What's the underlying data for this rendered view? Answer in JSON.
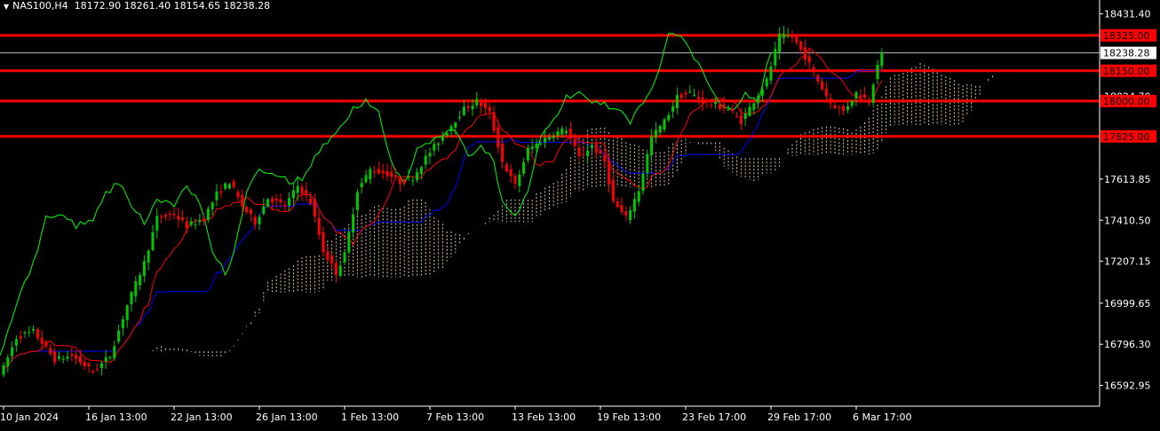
{
  "header": {
    "symbol_timeframe": "NAS100,H4",
    "open": "18172.90",
    "high": "18261.40",
    "low": "18154.65",
    "close": "18238.28"
  },
  "chart_data": {
    "type": "candlestick",
    "symbol": "NAS100",
    "timeframe": "H4",
    "ylim": [
      16490,
      18500
    ],
    "y_ticks": [
      "18431.40",
      "18024.70",
      "17613.85",
      "17410.50",
      "17207.15",
      "16999.65",
      "16796.30",
      "16592.95"
    ],
    "x_ticks": [
      "10 Jan 2024",
      "16 Jan 13:00",
      "22 Jan 13:00",
      "26 Jan 13:00",
      "1 Feb 13:00",
      "7 Feb 13:00",
      "13 Feb 13:00",
      "19 Feb 13:00",
      "23 Feb 17:00",
      "29 Feb 17:00",
      "6 Mar 17:00"
    ],
    "x_tick_index": [
      0,
      20,
      40,
      60,
      80,
      100,
      120,
      140,
      160,
      180,
      200
    ],
    "current_price": {
      "value": 18238.28,
      "label": "18238.28"
    },
    "levels": [
      {
        "value": 18325,
        "label": "18325.00"
      },
      {
        "value": 18150,
        "label": "18150.00"
      },
      {
        "value": 18000,
        "label": "18000.00"
      },
      {
        "value": 17825,
        "label": "17825.00"
      }
    ],
    "colors": {
      "background": "#000000",
      "bull": "#00c800",
      "bear": "#ff0000",
      "tenkan": "#ff0000",
      "kijun": "#0000ff",
      "chikou": "#00ff00",
      "cloud": "#f5deb3",
      "level": "#ff0000",
      "grid_text": "#ffffff"
    },
    "waypoints": [
      [
        0,
        16680
      ],
      [
        3,
        16830
      ],
      [
        7,
        16860
      ],
      [
        12,
        16720
      ],
      [
        16,
        16740
      ],
      [
        21,
        16660
      ],
      [
        25,
        16740
      ],
      [
        29,
        16990
      ],
      [
        33,
        17200
      ],
      [
        36,
        17420
      ],
      [
        40,
        17440
      ],
      [
        43,
        17380
      ],
      [
        47,
        17420
      ],
      [
        50,
        17540
      ],
      [
        53,
        17600
      ],
      [
        56,
        17480
      ],
      [
        59,
        17400
      ],
      [
        62,
        17520
      ],
      [
        66,
        17480
      ],
      [
        69,
        17580
      ],
      [
        72,
        17500
      ],
      [
        75,
        17260
      ],
      [
        78,
        17150
      ],
      [
        80,
        17240
      ],
      [
        83,
        17560
      ],
      [
        86,
        17660
      ],
      [
        90,
        17640
      ],
      [
        93,
        17600
      ],
      [
        96,
        17620
      ],
      [
        99,
        17720
      ],
      [
        102,
        17800
      ],
      [
        105,
        17880
      ],
      [
        108,
        17960
      ],
      [
        111,
        18000
      ],
      [
        114,
        17940
      ],
      [
        117,
        17700
      ],
      [
        120,
        17580
      ],
      [
        123,
        17760
      ],
      [
        126,
        17800
      ],
      [
        129,
        17840
      ],
      [
        132,
        17860
      ],
      [
        135,
        17720
      ],
      [
        138,
        17780
      ],
      [
        141,
        17700
      ],
      [
        143,
        17500
      ],
      [
        146,
        17420
      ],
      [
        149,
        17560
      ],
      [
        152,
        17820
      ],
      [
        155,
        17900
      ],
      [
        158,
        18020
      ],
      [
        161,
        18040
      ],
      [
        164,
        18000
      ],
      [
        167,
        17980
      ],
      [
        170,
        17960
      ],
      [
        173,
        17900
      ],
      [
        176,
        18000
      ],
      [
        179,
        18100
      ],
      [
        182,
        18320
      ],
      [
        185,
        18320
      ],
      [
        188,
        18220
      ],
      [
        191,
        18100
      ],
      [
        194,
        17990
      ],
      [
        197,
        17950
      ],
      [
        200,
        18040
      ],
      [
        203,
        18000
      ],
      [
        205,
        18190
      ],
      [
        206,
        18238.28
      ]
    ]
  }
}
